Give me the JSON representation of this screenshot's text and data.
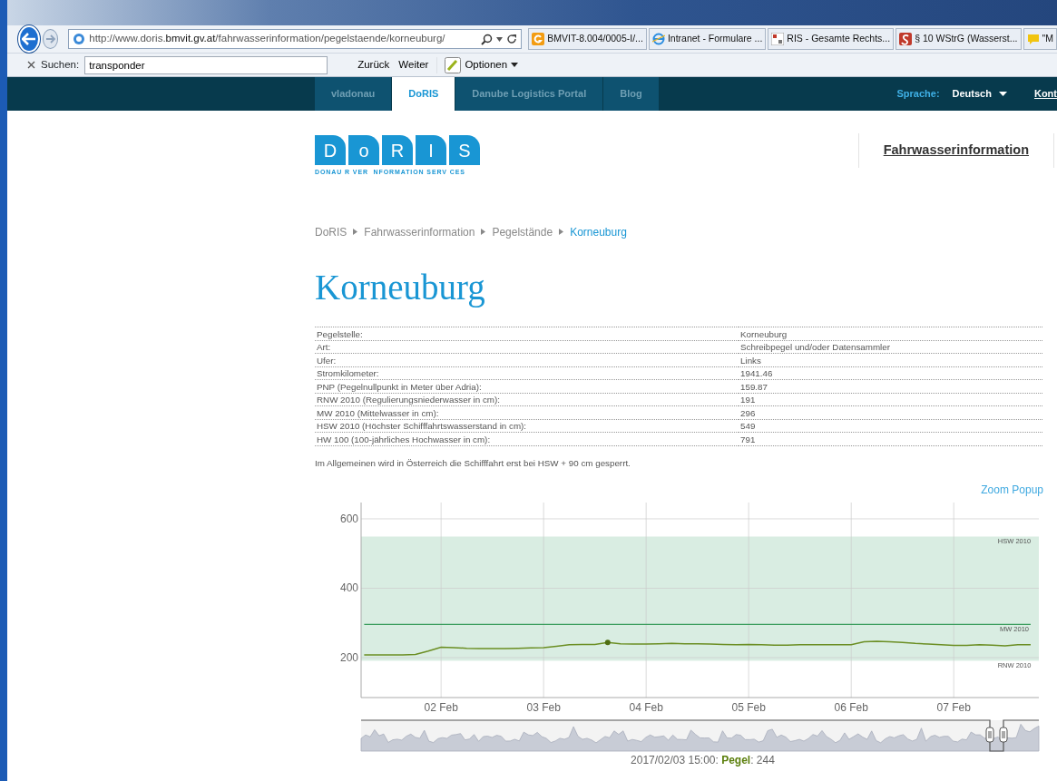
{
  "browser": {
    "address": "http://www.doris.**bmvit.gv.at**/fahrwasserinformation/pegelstaende/korneuburg/",
    "tabs": [
      {
        "label": "BMVIT-8.004/0005-I/...",
        "kind": "g"
      },
      {
        "label": "Intranet - Formulare ...",
        "kind": "e"
      },
      {
        "label": "RIS - Gesamte Rechts...",
        "kind": "ris"
      },
      {
        "label": "§ 10 WStrG (Wasserst...",
        "kind": "s"
      },
      {
        "label": "\"M",
        "kind": "note"
      }
    ]
  },
  "find_bar": {
    "label": "Suchen:",
    "value": "transponder",
    "buttons": [
      "Zurück",
      "Weiter"
    ],
    "options": "Optionen"
  },
  "site_nav": {
    "tabs": [
      {
        "label": "vladonau",
        "selected": false
      },
      {
        "label": "DoRIS",
        "selected": true
      },
      {
        "label": "Danube Logistics Portal",
        "selected": false
      },
      {
        "label": "Blog",
        "selected": false
      }
    ],
    "language_label": "Sprache:",
    "language": "Deutsch",
    "cut_item": "Kont"
  },
  "logo": {
    "letters": [
      "D",
      "o",
      "R",
      "I",
      "S"
    ],
    "tagline": "DONAU R VER  NFORMATION SERV CES"
  },
  "menu": [
    "Fahrwasserinformation"
  ],
  "breadcrumb": [
    {
      "label": "DoRIS",
      "current": false
    },
    {
      "label": "Fahrwasserinformation",
      "current": false
    },
    {
      "label": "Pegelstände",
      "current": false
    },
    {
      "label": "Korneuburg",
      "current": true
    }
  ],
  "title": "Korneuburg",
  "details": [
    {
      "label": "Pegelstelle:",
      "value": "Korneuburg"
    },
    {
      "label": "Art:",
      "value": "Schreibpegel und/oder Datensammler"
    },
    {
      "label": "Ufer:",
      "value": "Links"
    },
    {
      "label": "Stromkilometer:",
      "value": "1941.46"
    },
    {
      "label": "PNP (Pegelnullpunkt in Meter über Adria):",
      "value": "159.87"
    },
    {
      "label": "RNW 2010 (Regulierungsniederwasser in cm):",
      "value": "191"
    },
    {
      "label": "MW 2010 (Mittelwasser in cm):",
      "value": "296"
    },
    {
      "label": "HSW 2010 (Höchster Schifffahrtswasserstand in cm):",
      "value": "549"
    },
    {
      "label": "HW 100 (100-jährliches Hochwasser in cm):",
      "value": "791"
    }
  ],
  "note": "Im Allgemeinen wird in Österreich die Schifffahrt erst bei HSW + 90 cm gesperrt.",
  "zoom_link": "Zoom Popup",
  "chart": {
    "chart_data": {
      "type": "line",
      "categories": [
        null,
        null,
        null,
        null,
        null,
        null,
        "02 Feb",
        null,
        null,
        null,
        null,
        null,
        null,
        null,
        "03 Feb",
        null,
        null,
        null,
        null,
        null,
        null,
        null,
        "04 Feb",
        null,
        null,
        null,
        null,
        null,
        null,
        null,
        "05 Feb",
        null,
        null,
        null,
        null,
        null,
        null,
        null,
        "06 Feb",
        null,
        null,
        null,
        null,
        null,
        null,
        null,
        "07 Feb",
        null,
        null,
        null,
        null,
        null,
        null
      ],
      "series": [
        {
          "name": "MW 2010",
          "color": "#3a9d5d",
          "values": [
            296,
            296,
            296,
            296,
            296,
            296,
            296,
            296,
            296,
            296,
            296,
            296,
            296,
            296,
            296,
            296,
            296,
            296,
            296,
            296,
            296,
            296,
            296,
            296,
            296,
            296,
            296,
            296,
            296,
            296,
            296,
            296,
            296,
            296,
            296,
            296,
            296,
            296,
            296,
            296,
            296,
            296,
            296,
            296,
            296,
            296,
            296,
            296,
            296,
            296,
            296,
            296,
            296
          ]
        },
        {
          "color": "#6b8e23",
          "values": [
            208,
            208,
            208,
            208,
            209,
            219,
            230,
            229,
            227,
            226,
            226,
            226,
            227,
            228,
            229,
            233,
            237,
            238,
            238,
            244,
            240,
            239,
            239,
            240,
            241,
            240,
            240,
            239,
            238,
            237,
            238,
            237,
            236,
            236,
            237,
            237,
            237,
            237,
            237,
            246,
            247,
            246,
            244,
            241,
            239,
            237,
            235,
            235,
            237,
            236,
            234,
            237,
            237
          ]
        },
        {
          "color": "#4f6e12",
          "marker": true,
          "values": [
            null,
            null,
            null,
            null,
            null,
            null,
            null,
            null,
            null,
            null,
            null,
            null,
            null,
            null,
            null,
            null,
            null,
            null,
            null,
            244,
            null,
            null,
            null,
            null,
            null,
            null,
            null,
            null,
            null,
            null,
            null,
            null,
            null,
            null,
            null,
            null,
            null,
            null,
            null,
            null,
            null,
            null,
            null,
            null,
            null,
            null,
            null,
            null,
            null,
            null,
            null,
            null,
            null
          ]
        }
      ],
      "ylim": [
        85,
        647
      ],
      "grid": true,
      "yticks": [
        200,
        400,
        600
      ],
      "bands": [
        {
          "axis": "y",
          "from": 191,
          "to": 549,
          "label": "HSW 2010"
        }
      ],
      "annotations": [
        "RNW 2010"
      ]
    },
    "tooltip": "2017/02/03 15:00: **Pegel**: 244"
  }
}
